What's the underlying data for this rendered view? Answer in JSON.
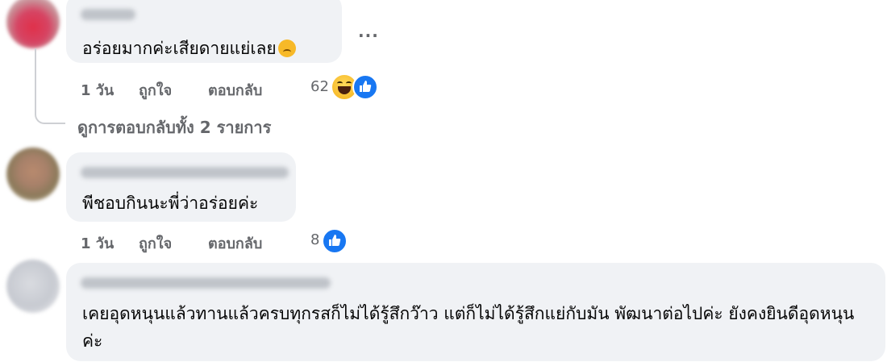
{
  "comments": [
    {
      "text": "อร่อยมากค่ะเสียดายแย่เลย",
      "emoji": "sad-tear-emoji",
      "time": "1 วัน",
      "like_label": "ถูกใจ",
      "reply_label": "ตอบกลับ",
      "reaction_count": "62",
      "reactions": [
        "haha",
        "like"
      ],
      "more_label": "···"
    },
    {
      "text": "พีชอบกินนะพี่ว่าอร่อยค่ะ",
      "time": "1 วัน",
      "like_label": "ถูกใจ",
      "reply_label": "ตอบกลับ",
      "reaction_count": "8",
      "reactions": [
        "like"
      ]
    },
    {
      "text": "เคยอุดหนุนแล้วทานแล้วครบทุกรสก็ไม่ได้รู้สึกว๊าว แต่ก็ไม่ได้รู้สึกแย่กับมัน พัฒนาต่อไปค่ะ ยังคงยินดีอุดหนุนค่ะ"
    }
  ],
  "view_replies": "ดูการตอบกลับทั้ง 2 รายการ",
  "colors": {
    "bubble": "#f0f2f5",
    "secondary_text": "#65676b",
    "like_blue": "#1877f2",
    "haha_yellow": "#f7b928"
  }
}
